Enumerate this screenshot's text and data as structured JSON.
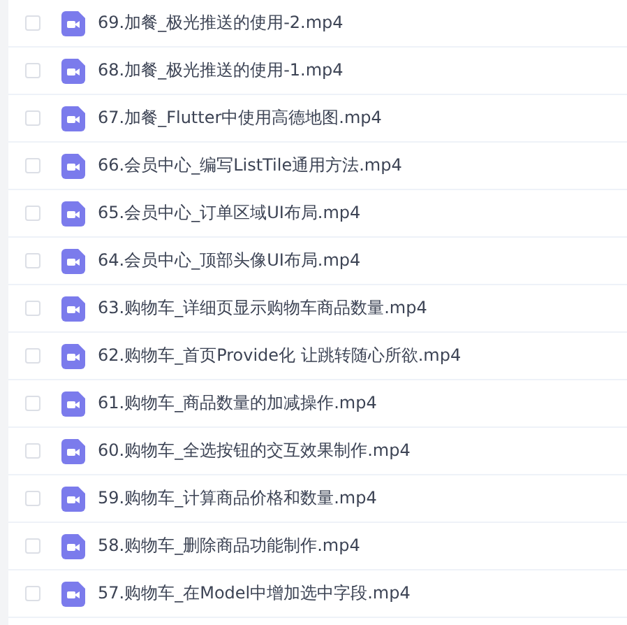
{
  "files": [
    {
      "name": "69.加餐_极光推送的使用-2.mp4",
      "checked": false
    },
    {
      "name": "68.加餐_极光推送的使用-1.mp4",
      "checked": false
    },
    {
      "name": "67.加餐_Flutter中使用高德地图.mp4",
      "checked": false
    },
    {
      "name": "66.会员中心_编写ListTile通用方法.mp4",
      "checked": false
    },
    {
      "name": "65.会员中心_订单区域UI布局.mp4",
      "checked": false
    },
    {
      "name": "64.会员中心_顶部头像UI布局.mp4",
      "checked": false
    },
    {
      "name": "63.购物车_详细页显示购物车商品数量.mp4",
      "checked": false
    },
    {
      "name": "62.购物车_首页Provide化 让跳转随心所欲.mp4",
      "checked": false
    },
    {
      "name": "61.购物车_商品数量的加减操作.mp4",
      "checked": false
    },
    {
      "name": "60.购物车_全选按钮的交互效果制作.mp4",
      "checked": false
    },
    {
      "name": "59.购物车_计算商品价格和数量.mp4",
      "checked": false
    },
    {
      "name": "58.购物车_删除商品功能制作.mp4",
      "checked": false
    },
    {
      "name": "57.购物车_在Model中增加选中字段.mp4",
      "checked": false
    }
  ]
}
